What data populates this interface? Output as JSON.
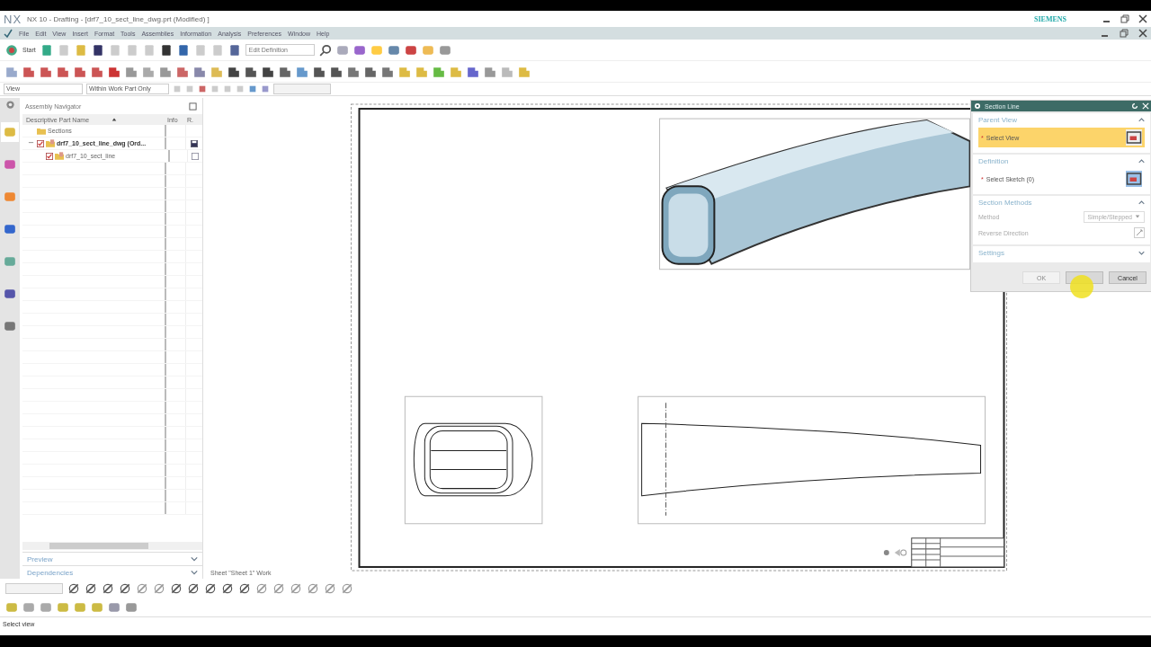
{
  "window": {
    "app": "NX",
    "title": "NX 10 - Drafting - [drf7_10_sect_line_dwg.prt (Modified) ]",
    "logo": "SIEMENS"
  },
  "menu": [
    "File",
    "Edit",
    "View",
    "Insert",
    "Format",
    "Tools",
    "Assemblies",
    "Information",
    "Analysis",
    "Preferences",
    "Window",
    "Help"
  ],
  "toolbar": {
    "start": "Start",
    "command_field": {
      "value": "Edit Definition"
    }
  },
  "filter_bar": {
    "type_filter": "View",
    "scope": "Within Work Part Only"
  },
  "side_tabs": [
    {
      "selected": true
    },
    {
      "selected": false
    },
    {
      "selected": false
    },
    {
      "selected": false
    },
    {
      "selected": false
    },
    {
      "selected": false
    },
    {
      "selected": false
    }
  ],
  "navigator": {
    "title": "Assembly Navigator",
    "columns": [
      "Descriptive Part Name",
      "Info",
      "R."
    ],
    "tree": [
      {
        "label": "Sections",
        "kind": "folder"
      },
      {
        "label": "drf7_10_sect_line_dwg (Ord...",
        "kind": "part",
        "checked": true,
        "bold": true,
        "expanded": true,
        "saved": true,
        "children": [
          {
            "label": "drf7_10_sect_line",
            "kind": "part",
            "checked": true,
            "bold": false,
            "saved": false
          }
        ]
      }
    ],
    "panels": [
      {
        "label": "Preview",
        "expanded": false
      },
      {
        "label": "Dependencies",
        "expanded": false
      }
    ]
  },
  "sheet": {
    "label": "Sheet \"Sheet 1\" Work"
  },
  "dialog": {
    "title": "Section Line",
    "groups": [
      {
        "title": "Parent View",
        "expanded": true,
        "rows": [
          {
            "kind": "select",
            "marker": "*",
            "label": "Select View",
            "active": true
          }
        ]
      },
      {
        "title": "Definition",
        "expanded": true,
        "rows": [
          {
            "kind": "select",
            "marker": "*",
            "label": "Select Sketch (0)",
            "active": false
          }
        ]
      },
      {
        "title": "Section Methods",
        "expanded": true,
        "rows": [
          {
            "kind": "dropdown",
            "label": "Method",
            "value": "Simple/Stepped"
          },
          {
            "kind": "toggle",
            "label": "Reverse Direction"
          }
        ]
      },
      {
        "title": "Settings",
        "expanded": false
      }
    ],
    "buttons": [
      {
        "label": "OK",
        "disabled": true
      },
      {
        "disabled": false
      },
      {
        "label": "Cancel",
        "disabled": false
      }
    ]
  },
  "status_bar": "Select view"
}
